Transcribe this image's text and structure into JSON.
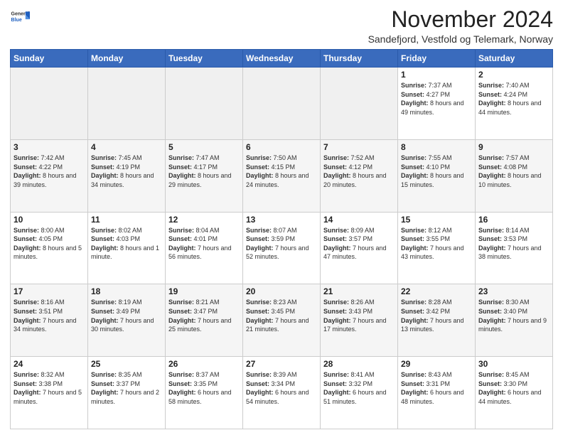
{
  "logo": {
    "general": "General",
    "blue": "Blue"
  },
  "header": {
    "month": "November 2024",
    "subtitle": "Sandefjord, Vestfold og Telemark, Norway"
  },
  "days_of_week": [
    "Sunday",
    "Monday",
    "Tuesday",
    "Wednesday",
    "Thursday",
    "Friday",
    "Saturday"
  ],
  "weeks": [
    [
      {
        "day": "",
        "info": ""
      },
      {
        "day": "",
        "info": ""
      },
      {
        "day": "",
        "info": ""
      },
      {
        "day": "",
        "info": ""
      },
      {
        "day": "",
        "info": ""
      },
      {
        "day": "1",
        "info": "Sunrise: 7:37 AM\nSunset: 4:27 PM\nDaylight: 8 hours and 49 minutes."
      },
      {
        "day": "2",
        "info": "Sunrise: 7:40 AM\nSunset: 4:24 PM\nDaylight: 8 hours and 44 minutes."
      }
    ],
    [
      {
        "day": "3",
        "info": "Sunrise: 7:42 AM\nSunset: 4:22 PM\nDaylight: 8 hours and 39 minutes."
      },
      {
        "day": "4",
        "info": "Sunrise: 7:45 AM\nSunset: 4:19 PM\nDaylight: 8 hours and 34 minutes."
      },
      {
        "day": "5",
        "info": "Sunrise: 7:47 AM\nSunset: 4:17 PM\nDaylight: 8 hours and 29 minutes."
      },
      {
        "day": "6",
        "info": "Sunrise: 7:50 AM\nSunset: 4:15 PM\nDaylight: 8 hours and 24 minutes."
      },
      {
        "day": "7",
        "info": "Sunrise: 7:52 AM\nSunset: 4:12 PM\nDaylight: 8 hours and 20 minutes."
      },
      {
        "day": "8",
        "info": "Sunrise: 7:55 AM\nSunset: 4:10 PM\nDaylight: 8 hours and 15 minutes."
      },
      {
        "day": "9",
        "info": "Sunrise: 7:57 AM\nSunset: 4:08 PM\nDaylight: 8 hours and 10 minutes."
      }
    ],
    [
      {
        "day": "10",
        "info": "Sunrise: 8:00 AM\nSunset: 4:05 PM\nDaylight: 8 hours and 5 minutes."
      },
      {
        "day": "11",
        "info": "Sunrise: 8:02 AM\nSunset: 4:03 PM\nDaylight: 8 hours and 1 minute."
      },
      {
        "day": "12",
        "info": "Sunrise: 8:04 AM\nSunset: 4:01 PM\nDaylight: 7 hours and 56 minutes."
      },
      {
        "day": "13",
        "info": "Sunrise: 8:07 AM\nSunset: 3:59 PM\nDaylight: 7 hours and 52 minutes."
      },
      {
        "day": "14",
        "info": "Sunrise: 8:09 AM\nSunset: 3:57 PM\nDaylight: 7 hours and 47 minutes."
      },
      {
        "day": "15",
        "info": "Sunrise: 8:12 AM\nSunset: 3:55 PM\nDaylight: 7 hours and 43 minutes."
      },
      {
        "day": "16",
        "info": "Sunrise: 8:14 AM\nSunset: 3:53 PM\nDaylight: 7 hours and 38 minutes."
      }
    ],
    [
      {
        "day": "17",
        "info": "Sunrise: 8:16 AM\nSunset: 3:51 PM\nDaylight: 7 hours and 34 minutes."
      },
      {
        "day": "18",
        "info": "Sunrise: 8:19 AM\nSunset: 3:49 PM\nDaylight: 7 hours and 30 minutes."
      },
      {
        "day": "19",
        "info": "Sunrise: 8:21 AM\nSunset: 3:47 PM\nDaylight: 7 hours and 25 minutes."
      },
      {
        "day": "20",
        "info": "Sunrise: 8:23 AM\nSunset: 3:45 PM\nDaylight: 7 hours and 21 minutes."
      },
      {
        "day": "21",
        "info": "Sunrise: 8:26 AM\nSunset: 3:43 PM\nDaylight: 7 hours and 17 minutes."
      },
      {
        "day": "22",
        "info": "Sunrise: 8:28 AM\nSunset: 3:42 PM\nDaylight: 7 hours and 13 minutes."
      },
      {
        "day": "23",
        "info": "Sunrise: 8:30 AM\nSunset: 3:40 PM\nDaylight: 7 hours and 9 minutes."
      }
    ],
    [
      {
        "day": "24",
        "info": "Sunrise: 8:32 AM\nSunset: 3:38 PM\nDaylight: 7 hours and 5 minutes."
      },
      {
        "day": "25",
        "info": "Sunrise: 8:35 AM\nSunset: 3:37 PM\nDaylight: 7 hours and 2 minutes."
      },
      {
        "day": "26",
        "info": "Sunrise: 8:37 AM\nSunset: 3:35 PM\nDaylight: 6 hours and 58 minutes."
      },
      {
        "day": "27",
        "info": "Sunrise: 8:39 AM\nSunset: 3:34 PM\nDaylight: 6 hours and 54 minutes."
      },
      {
        "day": "28",
        "info": "Sunrise: 8:41 AM\nSunset: 3:32 PM\nDaylight: 6 hours and 51 minutes."
      },
      {
        "day": "29",
        "info": "Sunrise: 8:43 AM\nSunset: 3:31 PM\nDaylight: 6 hours and 48 minutes."
      },
      {
        "day": "30",
        "info": "Sunrise: 8:45 AM\nSunset: 3:30 PM\nDaylight: 6 hours and 44 minutes."
      }
    ]
  ]
}
